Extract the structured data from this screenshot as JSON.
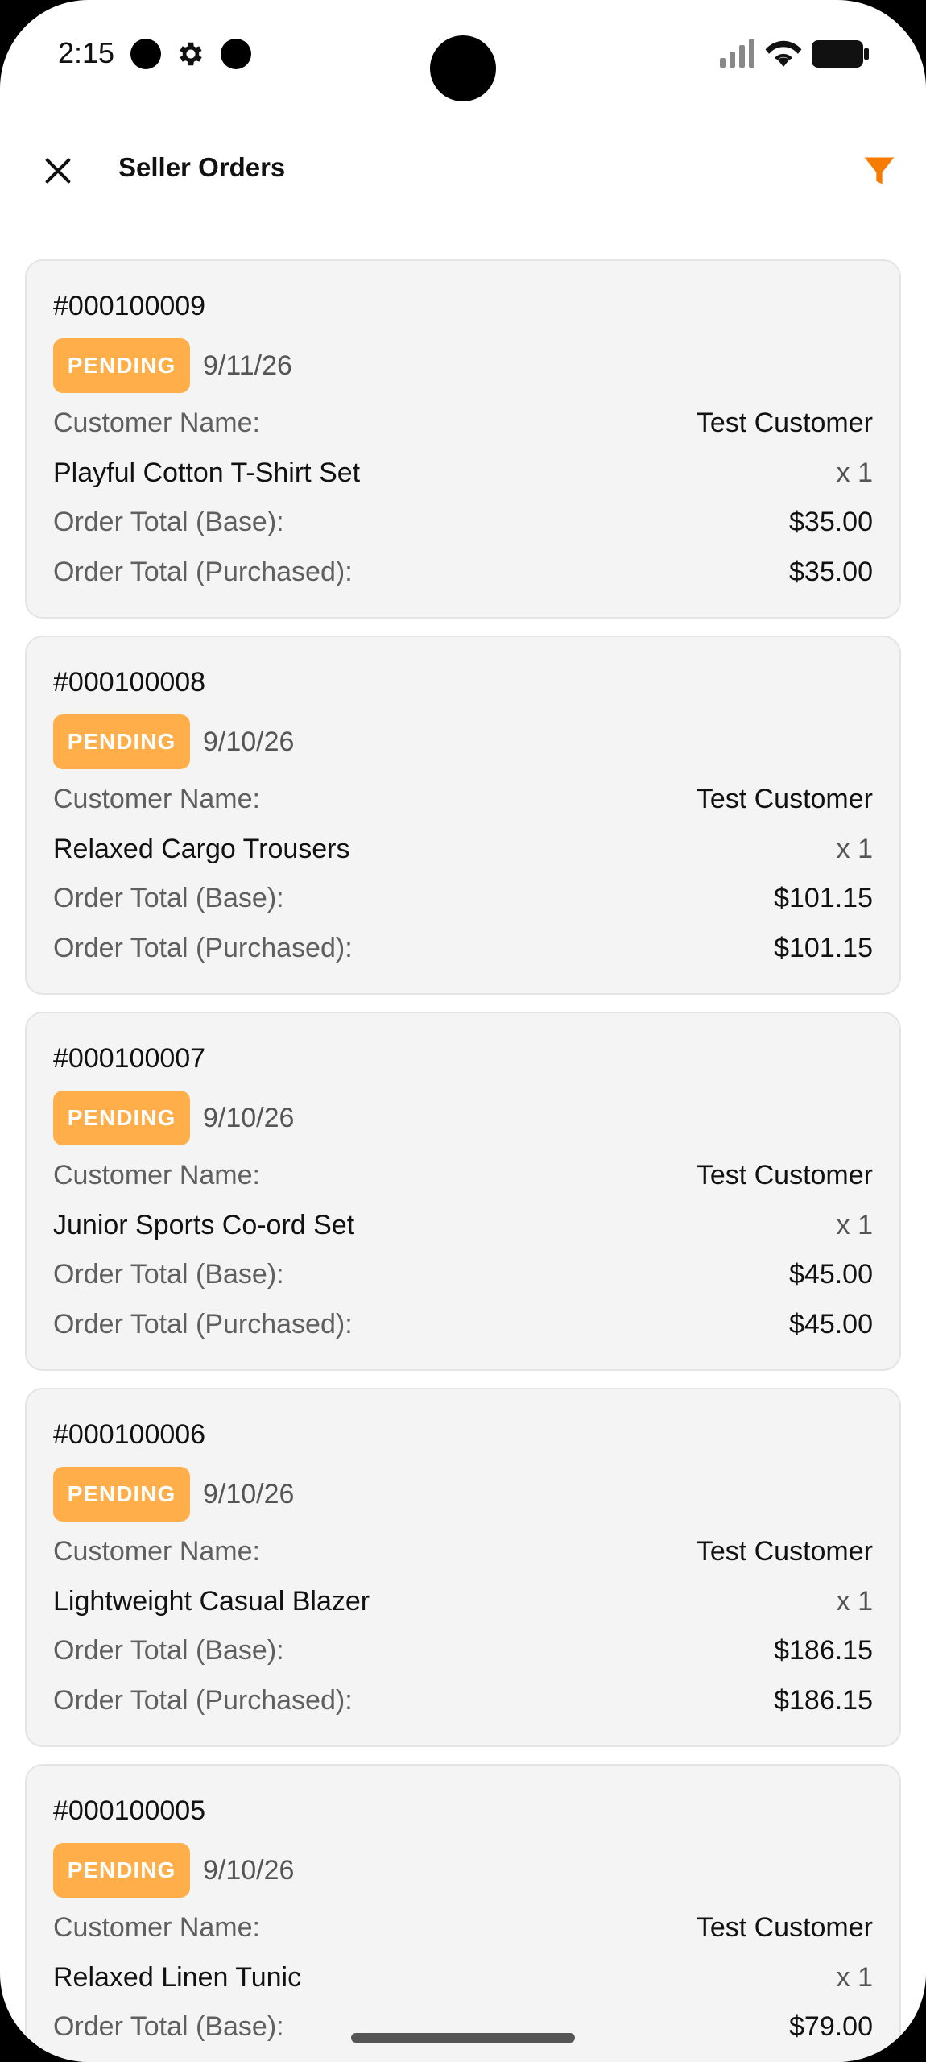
{
  "status_bar": {
    "time": "2:15"
  },
  "header": {
    "title": "Seller Orders",
    "close_icon": "close-icon",
    "filter_icon": "filter-icon",
    "accent_color": "#f57c00"
  },
  "labels": {
    "customer_name": "Customer Name:",
    "order_total_base": "Order Total (Base):",
    "order_total_purchased": "Order Total (Purchased):"
  },
  "badge_color": "#ffae4a",
  "orders": [
    {
      "number": "#000100009",
      "status": "PENDING",
      "date": "9/11/26",
      "customer": "Test Customer",
      "product": "Playful Cotton T-Shirt Set",
      "qty": "x 1",
      "total_base": "$35.00",
      "total_purchased": "$35.00"
    },
    {
      "number": "#000100008",
      "status": "PENDING",
      "date": "9/10/26",
      "customer": "Test Customer",
      "product": "Relaxed Cargo Trousers",
      "qty": "x 1",
      "total_base": "$101.15",
      "total_purchased": "$101.15"
    },
    {
      "number": "#000100007",
      "status": "PENDING",
      "date": "9/10/26",
      "customer": "Test Customer",
      "product": "Junior Sports Co-ord Set",
      "qty": "x 1",
      "total_base": "$45.00",
      "total_purchased": "$45.00"
    },
    {
      "number": "#000100006",
      "status": "PENDING",
      "date": "9/10/26",
      "customer": "Test Customer",
      "product": "Lightweight Casual Blazer",
      "qty": "x 1",
      "total_base": "$186.15",
      "total_purchased": "$186.15"
    },
    {
      "number": "#000100005",
      "status": "PENDING",
      "date": "9/10/26",
      "customer": "Test Customer",
      "product": "Relaxed Linen Tunic",
      "qty": "x 1",
      "total_base": "$79.00",
      "total_purchased": ""
    }
  ]
}
